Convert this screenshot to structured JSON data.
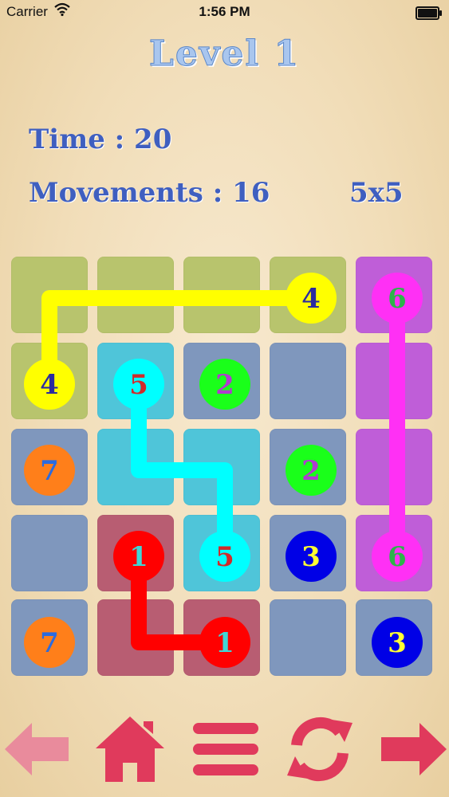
{
  "status_bar": {
    "carrier": "Carrier",
    "time": "1:56 PM"
  },
  "header": {
    "level_title": "Level 1",
    "time_label": "Time : 20",
    "movements_label": "Movements : 16",
    "grid_size_label": "5x5"
  },
  "board": {
    "rows": 5,
    "cols": 5,
    "cell_colors": [
      [
        "#b8c46d",
        "#b8c46d",
        "#b8c46d",
        "#b8c46d",
        "#bf5ed8"
      ],
      [
        "#b8c46d",
        "#4fc5d9",
        "#7f97bd",
        "#7f97bd",
        "#bf5ed8"
      ],
      [
        "#7f97bd",
        "#4fc5d9",
        "#4fc5d9",
        "#7f97bd",
        "#bf5ed8"
      ],
      [
        "#7f97bd",
        "#b85d72",
        "#4fc5d9",
        "#7f97bd",
        "#bf5ed8"
      ],
      [
        "#7f97bd",
        "#b85d72",
        "#b85d72",
        "#7f97bd",
        "#7f97bd"
      ]
    ],
    "dots": [
      {
        "row": 0,
        "col": 3,
        "number": "4",
        "fill": "#ffff00",
        "text_color": "#2b2ba0"
      },
      {
        "row": 1,
        "col": 0,
        "number": "4",
        "fill": "#ffff00",
        "text_color": "#2b2ba0"
      },
      {
        "row": 0,
        "col": 4,
        "number": "6",
        "fill": "#ff30f5",
        "text_color": "#2db34a"
      },
      {
        "row": 3,
        "col": 4,
        "number": "6",
        "fill": "#ff30f5",
        "text_color": "#2db34a"
      },
      {
        "row": 1,
        "col": 1,
        "number": "5",
        "fill": "#00ffff",
        "text_color": "#d22a2a"
      },
      {
        "row": 3,
        "col": 2,
        "number": "5",
        "fill": "#00ffff",
        "text_color": "#d22a2a"
      },
      {
        "row": 1,
        "col": 2,
        "number": "2",
        "fill": "#1aff1a",
        "text_color": "#b03ad0"
      },
      {
        "row": 2,
        "col": 3,
        "number": "2",
        "fill": "#1aff1a",
        "text_color": "#b03ad0"
      },
      {
        "row": 2,
        "col": 0,
        "number": "7",
        "fill": "#ff7f1a",
        "text_color": "#2a6be0"
      },
      {
        "row": 4,
        "col": 0,
        "number": "7",
        "fill": "#ff7f1a",
        "text_color": "#2a6be0"
      },
      {
        "row": 3,
        "col": 1,
        "number": "1",
        "fill": "#ff0000",
        "text_color": "#3fd6d6"
      },
      {
        "row": 4,
        "col": 2,
        "number": "1",
        "fill": "#ff0000",
        "text_color": "#3fd6d6"
      },
      {
        "row": 3,
        "col": 3,
        "number": "3",
        "fill": "#0000e6",
        "text_color": "#ffff33"
      },
      {
        "row": 4,
        "col": 4,
        "number": "3",
        "fill": "#0000e6",
        "text_color": "#ffff33"
      }
    ],
    "paths": [
      {
        "color": "#ffff00",
        "cells": [
          [
            0,
            3
          ],
          [
            0,
            0.5
          ],
          [
            1,
            0
          ]
        ]
      },
      {
        "color": "#ff30f5",
        "cells": [
          [
            0,
            4
          ],
          [
            3,
            4
          ]
        ]
      },
      {
        "color": "#00ffff",
        "cells": [
          [
            1,
            1
          ],
          [
            2,
            1
          ],
          [
            2,
            2
          ],
          [
            3,
            2
          ]
        ]
      },
      {
        "color": "#ff0000",
        "cells": [
          [
            3,
            1
          ],
          [
            4,
            1
          ],
          [
            4,
            2
          ]
        ]
      }
    ]
  },
  "toolbar": {
    "accent_color": "#e03a5c",
    "buttons": [
      {
        "icon": "arrow-left-icon",
        "color": "#e98b9c"
      },
      {
        "icon": "home-icon",
        "color": "#e03a5c"
      },
      {
        "icon": "menu-icon",
        "color": "#e03a5c"
      },
      {
        "icon": "refresh-icon",
        "color": "#e03a5c"
      },
      {
        "icon": "arrow-right-icon",
        "color": "#e03a5c"
      }
    ]
  }
}
